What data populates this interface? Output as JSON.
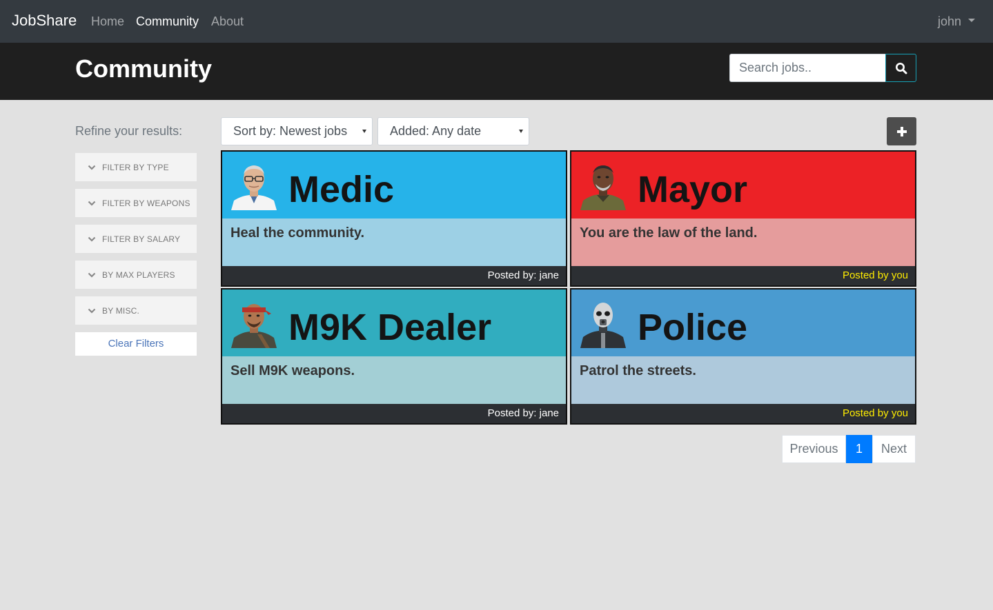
{
  "navbar": {
    "brand": "JobShare",
    "links": [
      {
        "label": "Home",
        "active": false
      },
      {
        "label": "Community",
        "active": true
      },
      {
        "label": "About",
        "active": false
      }
    ],
    "user": "john"
  },
  "header": {
    "title": "Community",
    "search_placeholder": "Search jobs.."
  },
  "sidebar": {
    "refine_label": "Refine your results:",
    "filters": [
      "FILTER BY TYPE",
      "FILTER BY WEAPONS",
      "FILTER BY SALARY",
      "BY MAX PLAYERS",
      "BY MISC."
    ],
    "clear_label": "Clear Filters"
  },
  "toolbar": {
    "sort_value": "Sort by: Newest jobs",
    "date_value": "Added: Any date"
  },
  "jobs": [
    {
      "title": "Medic",
      "description": "Heal the community.",
      "posted": "Posted by: jane",
      "posted_by_you": false,
      "top_color": "#26b3e9",
      "mid_color": "#9dd0e5",
      "avatar": "medic-avatar"
    },
    {
      "title": "Mayor",
      "description": "You are the law of the land.",
      "posted": "Posted by you",
      "posted_by_you": true,
      "top_color": "#ec2226",
      "mid_color": "#e59c9c",
      "avatar": "mayor-avatar"
    },
    {
      "title": "M9K Dealer",
      "description": "Sell M9K weapons.",
      "posted": "Posted by: jane",
      "posted_by_you": false,
      "top_color": "#31adbf",
      "mid_color": "#a3cfd5",
      "avatar": "dealer-avatar"
    },
    {
      "title": "Police",
      "description": "Patrol the streets.",
      "posted": "Posted by you",
      "posted_by_you": true,
      "top_color": "#4a9bd0",
      "mid_color": "#aec9dc",
      "avatar": "police-avatar"
    }
  ],
  "pagination": {
    "previous": "Previous",
    "current": "1",
    "next": "Next"
  },
  "colors": {
    "navbar_bg": "#343a40",
    "header_bg": "#1f1f1f",
    "page_bg": "#e1e1e1",
    "accent_blue": "#007bff",
    "posted_by_you": "#ffed00"
  }
}
